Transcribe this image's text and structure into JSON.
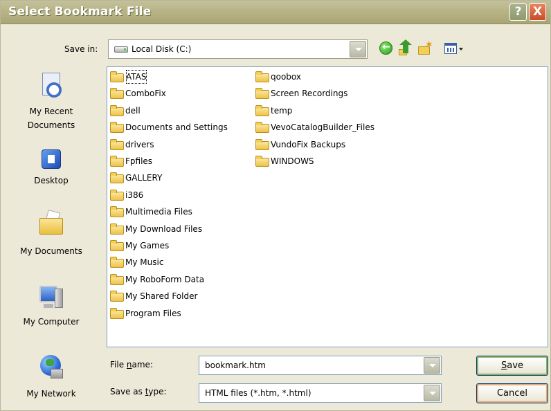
{
  "window": {
    "title": "Select Bookmark File",
    "help_glyph": "?",
    "close_glyph": "X"
  },
  "toolbar": {
    "save_in_label": "Save in:",
    "save_in_value": "Local Disk (C:)",
    "icons": [
      "back-icon",
      "up-folder-icon",
      "new-folder-icon",
      "views-menu-icon"
    ]
  },
  "places": [
    {
      "label": "My Recent Documents",
      "icon": "recent-documents-icon"
    },
    {
      "label": "Desktop",
      "icon": "desktop-icon"
    },
    {
      "label": "My Documents",
      "icon": "my-documents-icon"
    },
    {
      "label": "My Computer",
      "icon": "my-computer-icon"
    },
    {
      "label": "My Network",
      "icon": "my-network-icon"
    }
  ],
  "folders": [
    "ATAS",
    "ComboFix",
    "dell",
    "Documents and Settings",
    "drivers",
    "Fpfiles",
    "GALLERY",
    "i386",
    "Multimedia Files",
    "My Download Files",
    "My Games",
    "My Music",
    "My RoboForm Data",
    "My Shared Folder",
    "Program Files",
    "qoobox",
    "Screen Recordings",
    "temp",
    "VevoCatalogBuilder_Files",
    "VundoFix Backups",
    "WINDOWS"
  ],
  "form": {
    "file_name_label": "File name:",
    "file_name_value": "bookmark.htm",
    "save_type_label": "Save as type:",
    "save_type_value": "HTML files (*.htm, *.html)"
  },
  "buttons": {
    "save": "Save",
    "cancel": "Cancel"
  }
}
